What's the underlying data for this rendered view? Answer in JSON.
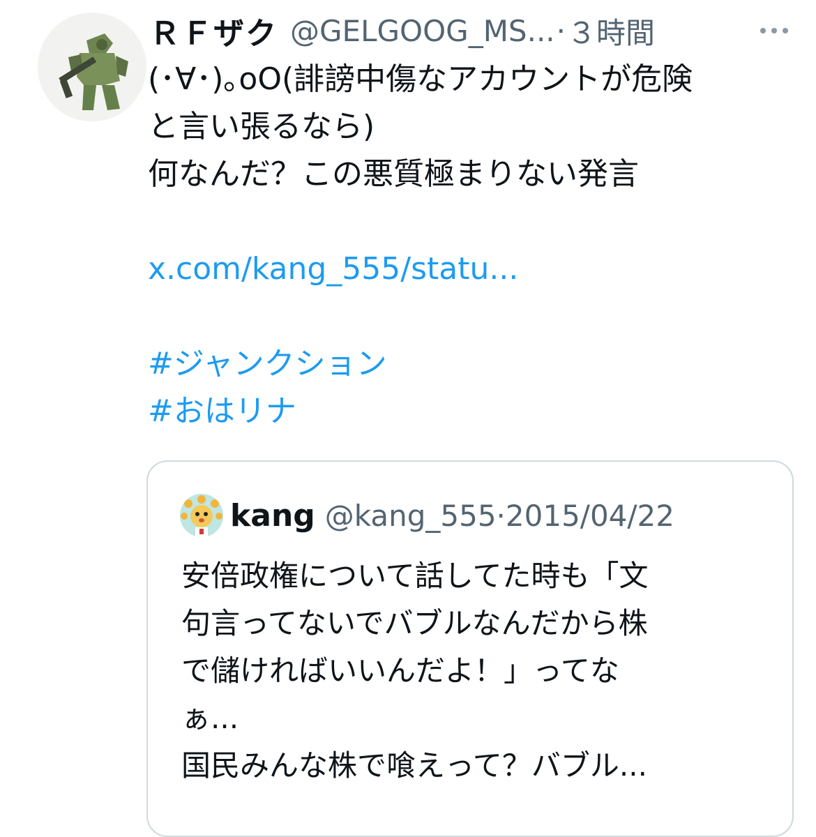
{
  "tweet": {
    "display_name": "ＲＦザク",
    "handle": "@GELGOOG_MS...",
    "separator": "·",
    "time": "３時間",
    "more_icon": "more-horizontal-icon",
    "lines": [
      "(･∀･)｡oO(誹謗中傷なアカウントが危険",
      "と言い張るなら)",
      "何なんだ？この悪質極まりない発言"
    ],
    "link": "x.com/kang_555/statu...",
    "hashtags": [
      "#ジャンクション",
      "#おはリナ"
    ]
  },
  "quote": {
    "display_name": "kang",
    "handle": "@kang_555",
    "separator": "·",
    "date": "2015/04/22",
    "lines": [
      "安倍政権について話してた時も「文",
      "句言ってないでバブルなんだから株",
      "で儲ければいいんだよ！」ってな",
      "ぁ...",
      "国民みんな株で喰えって？バブル..."
    ]
  },
  "colors": {
    "link": "#1d9bf0",
    "secondary": "#536471",
    "border": "#cfd9de"
  }
}
